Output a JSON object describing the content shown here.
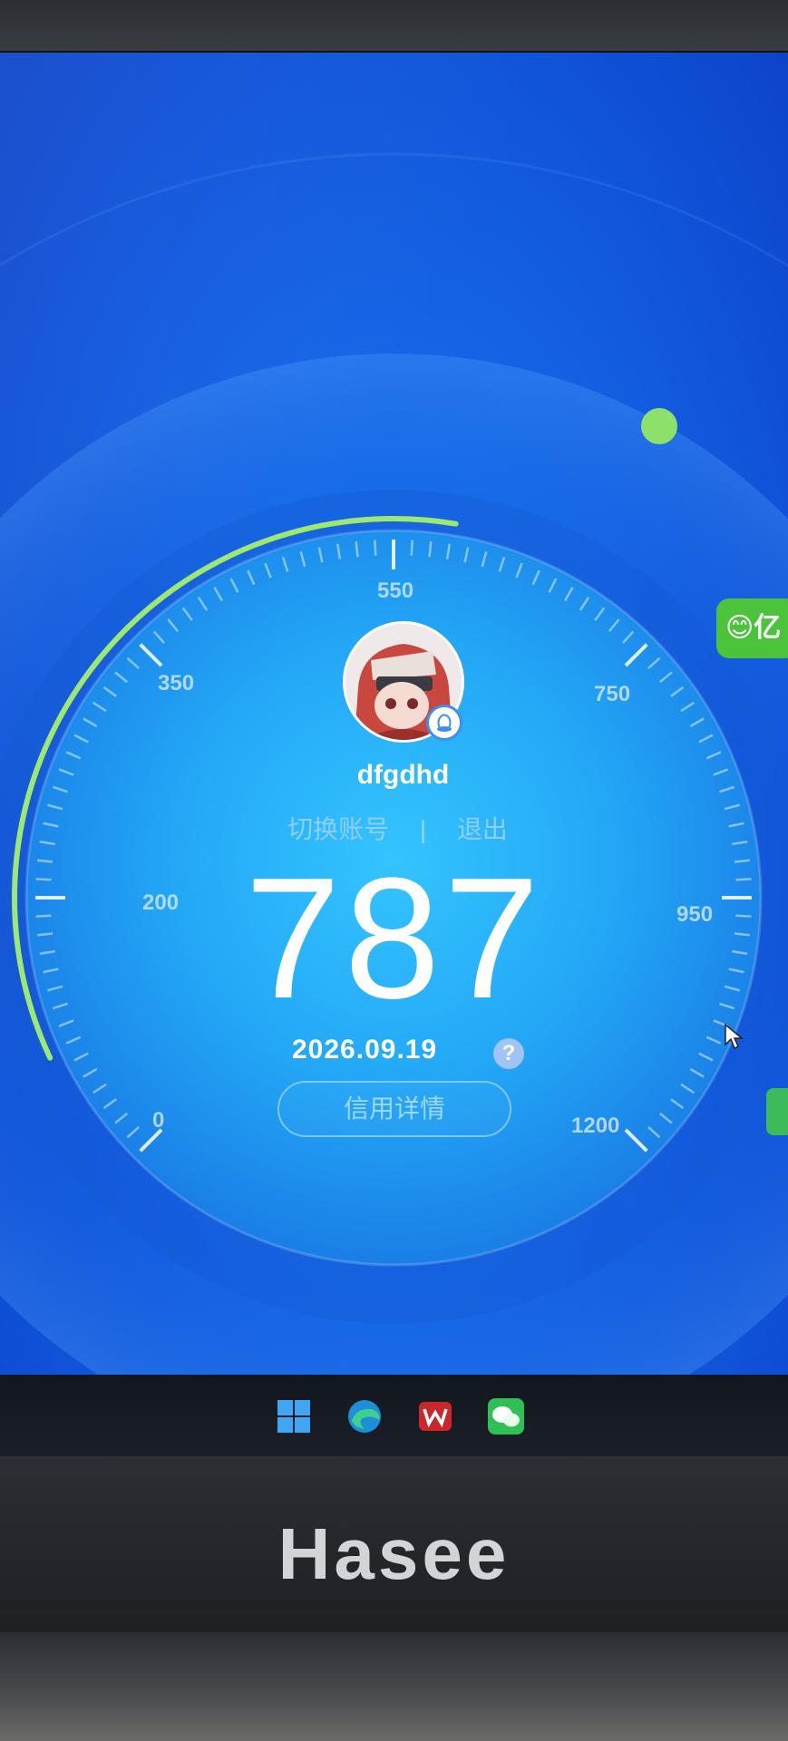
{
  "user": {
    "name": "dfgdhd",
    "switch_account_label": "切换账号",
    "separator": "|",
    "logout_label": "退出"
  },
  "credit": {
    "score": 787,
    "score_text": "787",
    "date": "2026.09.19",
    "help_symbol": "?",
    "detail_button": "信用详情"
  },
  "gauge": {
    "min": 0,
    "max": 1200,
    "ticks": [
      "0",
      "200",
      "350",
      "550",
      "750",
      "950",
      "1200"
    ],
    "colors": {
      "progress_arc": "#9ee86f",
      "face_inner": "#27b8ff",
      "face_outer": "#1e7fe8"
    }
  },
  "badges": {
    "chat_badge_text": "😊亿"
  },
  "taskbar": {
    "icons": [
      "windows-start-icon",
      "edge-browser-icon",
      "wps-office-icon",
      "wechat-icon"
    ]
  },
  "laptop": {
    "brand": "Hasee"
  }
}
